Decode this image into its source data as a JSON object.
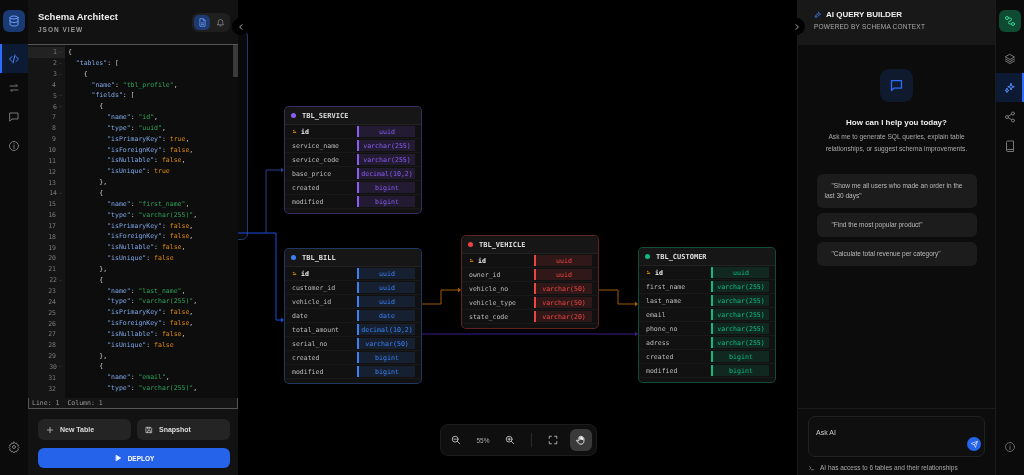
{
  "left_rail": {
    "items": [
      {
        "kind": "code",
        "selected": true
      },
      {
        "kind": "swap",
        "selected": false
      },
      {
        "kind": "chat",
        "selected": false
      },
      {
        "kind": "info",
        "selected": false
      }
    ]
  },
  "schema_panel": {
    "title": "Schema Architect",
    "subtitle": "JSON VIEW",
    "view_toggle": [
      {
        "kind": "file",
        "selected": true
      },
      {
        "kind": "bell",
        "selected": false
      }
    ],
    "editor": {
      "lines": [
        {
          "number": "1",
          "text": "{",
          "foldable": true
        },
        {
          "number": "2",
          "text": "  \"tables\": [",
          "foldable": true
        },
        {
          "number": "3",
          "text": "    {",
          "foldable": true
        },
        {
          "number": "4",
          "text": "      \"name\": \"tbl_profile\",",
          "foldable": false
        },
        {
          "number": "5",
          "text": "      \"fields\": [",
          "foldable": true
        },
        {
          "number": "6",
          "text": "        {",
          "foldable": true
        },
        {
          "number": "7",
          "text": "          \"name\": \"id\",",
          "foldable": false
        },
        {
          "number": "8",
          "text": "          \"type\": \"uuid\",",
          "foldable": false
        },
        {
          "number": "9",
          "text": "          \"isPrimaryKey\": true,",
          "foldable": false
        },
        {
          "number": "10",
          "text": "          \"isForeignKey\": false,",
          "foldable": false
        },
        {
          "number": "11",
          "text": "          \"isNullable\": false,",
          "foldable": false
        },
        {
          "number": "12",
          "text": "          \"isUnique\": true",
          "foldable": false
        },
        {
          "number": "13",
          "text": "        },",
          "foldable": false
        },
        {
          "number": "14",
          "text": "        {",
          "foldable": true
        },
        {
          "number": "15",
          "text": "          \"name\": \"first_name\",",
          "foldable": false
        },
        {
          "number": "16",
          "text": "          \"type\": \"varchar(255)\",",
          "foldable": false
        },
        {
          "number": "17",
          "text": "          \"isPrimaryKey\": false,",
          "foldable": false
        },
        {
          "number": "18",
          "text": "          \"isForeignKey\": false,",
          "foldable": false
        },
        {
          "number": "19",
          "text": "          \"isNullable\": false,",
          "foldable": false
        },
        {
          "number": "20",
          "text": "          \"isUnique\": false",
          "foldable": false
        },
        {
          "number": "21",
          "text": "        },",
          "foldable": false
        },
        {
          "number": "22",
          "text": "        {",
          "foldable": true
        },
        {
          "number": "23",
          "text": "          \"name\": \"last_name\",",
          "foldable": false
        },
        {
          "number": "24",
          "text": "          \"type\": \"varchar(255)\",",
          "foldable": false
        },
        {
          "number": "25",
          "text": "          \"isPrimaryKey\": false,",
          "foldable": false
        },
        {
          "number": "26",
          "text": "          \"isForeignKey\": false,",
          "foldable": false
        },
        {
          "number": "27",
          "text": "          \"isNullable\": false,",
          "foldable": false
        },
        {
          "number": "28",
          "text": "          \"isUnique\": false",
          "foldable": false
        },
        {
          "number": "29",
          "text": "        },",
          "foldable": false
        },
        {
          "number": "30",
          "text": "        {",
          "foldable": true
        },
        {
          "number": "31",
          "text": "          \"name\": \"email\",",
          "foldable": false
        },
        {
          "number": "32",
          "text": "          \"type\": \"varchar(255)\",",
          "foldable": false
        }
      ],
      "status": {
        "line": "Line: 1",
        "column": "Column: 1"
      }
    },
    "buttons": [
      {
        "kind": "plus",
        "label": "New Table"
      },
      {
        "kind": "save",
        "label": "Snapshot"
      }
    ],
    "deploy": {
      "label": "DEPLOY"
    }
  },
  "canvas": {
    "tables": [
      {
        "name": "TBL_SERVICE",
        "color": "#8b5cf6",
        "fields": [
          {
            "name": "id",
            "type": "uuid",
            "primary_key": true
          },
          {
            "name": "service_name",
            "type": "varchar(255)",
            "primary_key": false
          },
          {
            "name": "service_code",
            "type": "varchar(255)",
            "primary_key": false
          },
          {
            "name": "base_price",
            "type": "decimal(10,2)",
            "primary_key": false
          },
          {
            "name": "created",
            "type": "bigint",
            "primary_key": false
          },
          {
            "name": "modified",
            "type": "bigint",
            "primary_key": false
          }
        ]
      },
      {
        "name": "TBL_BILL",
        "color": "#3b82f6",
        "fields": [
          {
            "name": "id",
            "type": "uuid",
            "primary_key": true
          },
          {
            "name": "customer_id",
            "type": "uuid",
            "primary_key": false
          },
          {
            "name": "vehicle_id",
            "type": "uuid",
            "primary_key": false
          },
          {
            "name": "date",
            "type": "date",
            "primary_key": false
          },
          {
            "name": "total_amount",
            "type": "decimal(10,2)",
            "primary_key": false
          },
          {
            "name": "serial_no",
            "type": "varchar(50)",
            "primary_key": false
          },
          {
            "name": "created",
            "type": "bigint",
            "primary_key": false
          },
          {
            "name": "modified",
            "type": "bigint",
            "primary_key": false
          }
        ]
      },
      {
        "name": "TBL_VEHICLE",
        "color": "#ef4444",
        "fields": [
          {
            "name": "id",
            "type": "uuid",
            "primary_key": true
          },
          {
            "name": "owner_id",
            "type": "uuid",
            "primary_key": false
          },
          {
            "name": "vehicle_no",
            "type": "varchar(50)",
            "primary_key": false
          },
          {
            "name": "vehicle_type",
            "type": "varchar(50)",
            "primary_key": false
          },
          {
            "name": "state_code",
            "type": "varchar(20)",
            "primary_key": false
          }
        ]
      },
      {
        "name": "TBL_CUSTOMER",
        "color": "#10b981",
        "fields": [
          {
            "name": "id",
            "type": "uuid",
            "primary_key": true
          },
          {
            "name": "first_name",
            "type": "varchar(255)",
            "primary_key": false
          },
          {
            "name": "last_name",
            "type": "varchar(255)",
            "primary_key": false
          },
          {
            "name": "email",
            "type": "varchar(255)",
            "primary_key": false
          },
          {
            "name": "phone_no",
            "type": "varchar(255)",
            "primary_key": false
          },
          {
            "name": "adress",
            "type": "varchar(255)",
            "primary_key": false
          },
          {
            "name": "created",
            "type": "bigint",
            "primary_key": false
          },
          {
            "name": "modified",
            "type": "bigint",
            "primary_key": false
          }
        ]
      }
    ],
    "zoom_bar": {
      "zoom_level": "55%",
      "tools": [
        {
          "kind": "fit",
          "selected": false
        },
        {
          "kind": "hand",
          "selected": true
        }
      ]
    }
  },
  "ai_panel": {
    "title": "AI QUERY BUILDER",
    "subtitle": "POWERED BY SCHEMA CONTEXT",
    "heading": "How can I help you today?",
    "intro": "Ask me to generate SQL queries, explain table relationships, or suggest schema improvements.",
    "suggestions": [
      "\"Show me all users who made an order in the last 30 days\"",
      "\"Find the most popular product\"",
      "\"Calculate total revenue per category\""
    ],
    "input": {
      "placeholder": "Ask AI"
    },
    "footer": "AI has access to 6 tables and their relationships"
  },
  "right_rail": {
    "items": [
      {
        "kind": "layers",
        "selected": false
      },
      {
        "kind": "sparkles",
        "selected": true
      },
      {
        "kind": "share",
        "selected": false
      },
      {
        "kind": "book",
        "selected": false
      }
    ]
  }
}
